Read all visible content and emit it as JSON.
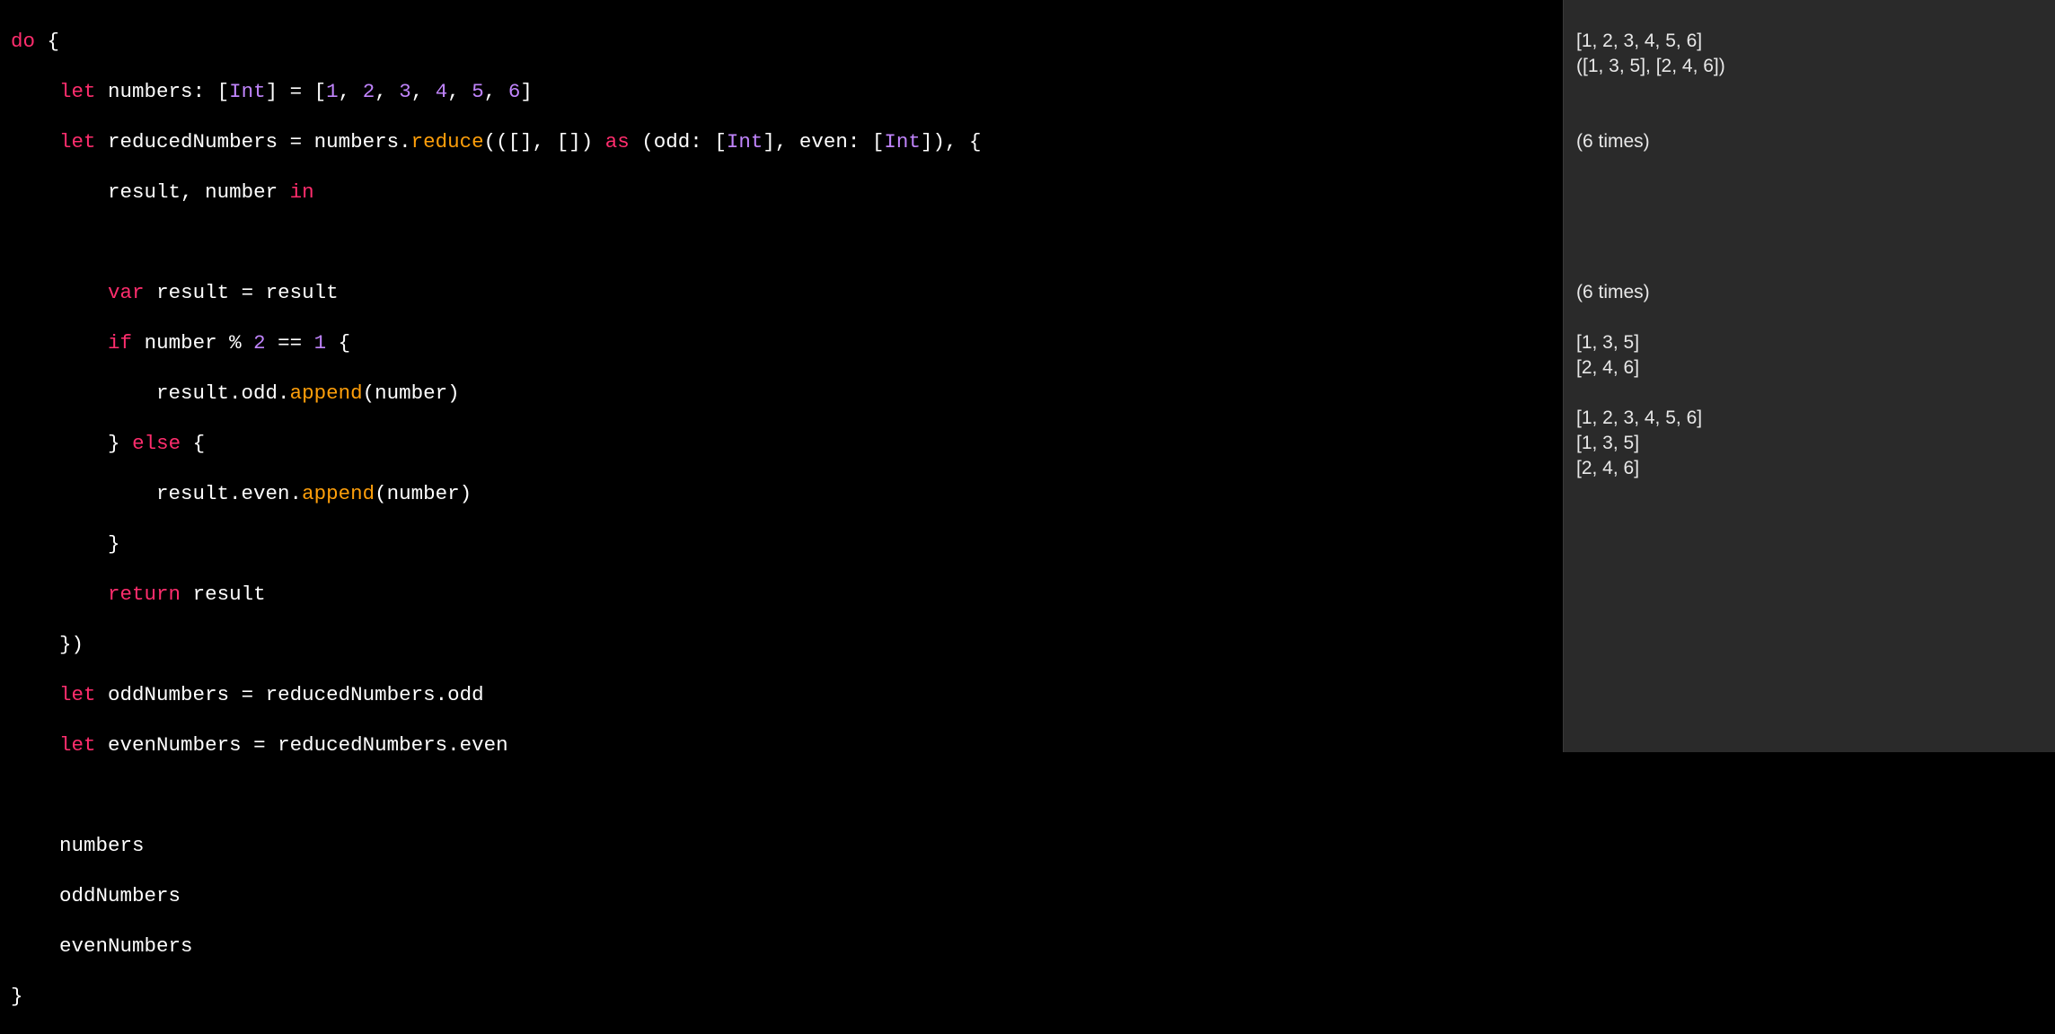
{
  "code": {
    "l1": {
      "do": "do",
      "brace": " {"
    },
    "l2": {
      "indent": "    ",
      "let": "let",
      "sp1": " ",
      "numbers": "numbers",
      "colon": ": ",
      "lbr": "[",
      "int": "Int",
      "rbr": "]",
      "eq": " = ",
      "l": "[",
      "n1": "1",
      "c1": ", ",
      "n2": "2",
      "c2": ", ",
      "n3": "3",
      "c3": ", ",
      "n4": "4",
      "c4": ", ",
      "n5": "5",
      "c5": ", ",
      "n6": "6",
      "r": "]"
    },
    "l3": {
      "indent": "    ",
      "let": "let",
      "sp1": " ",
      "rn": "reducedNumbers",
      "eq": " = ",
      "numcall": "numbers.",
      "reduce": "reduce",
      "op": "((",
      "e1": "[]",
      "cm1": ", ",
      "e2": "[]",
      "cp": ")",
      "sp2": " ",
      "as": "as",
      "sp3": " ",
      "op2": "(",
      "odd": "odd",
      "co1": ": ",
      "lb1": "[",
      "int1": "Int",
      "rb1": "]",
      "cm2": ", ",
      "even": "even",
      "co2": ": ",
      "lb2": "[",
      "int2": "Int",
      "rb2": "]",
      "cp2": ")",
      "cm3": ", ",
      "ob": "{"
    },
    "l4": {
      "indent": "        ",
      "result": "result",
      "cm": ", ",
      "number": "number",
      "sp": " ",
      "in": "in"
    },
    "l5": {
      "blank": ""
    },
    "l6": {
      "indent": "        ",
      "var": "var",
      "sp": " ",
      "result": "result",
      "eq": " = ",
      "result2": "result"
    },
    "l7": {
      "indent": "        ",
      "if": "if",
      "sp": " ",
      "number": "number",
      "op": " % ",
      "two": "2",
      "eq": " == ",
      "one": "1",
      "sp2": " ",
      "ob": "{"
    },
    "l8": {
      "indent": "            ",
      "resodd": "result.odd.",
      "append": "append",
      "op": "(",
      "number": "number",
      "cp": ")"
    },
    "l9": {
      "indent": "        ",
      "cb": "}",
      "sp": " ",
      "else": "else",
      "sp2": " ",
      "ob": "{"
    },
    "l10": {
      "indent": "            ",
      "reseven": "result.even.",
      "append": "append",
      "op": "(",
      "number": "number",
      "cp": ")"
    },
    "l11": {
      "indent": "        ",
      "cb": "}"
    },
    "l12": {
      "indent": "        ",
      "return": "return",
      "sp": " ",
      "result": "result"
    },
    "l13": {
      "indent": "    ",
      "cb": "})"
    },
    "l14": {
      "indent": "    ",
      "let": "let",
      "sp": " ",
      "oddN": "oddNumbers",
      "eq": " = ",
      "rhs": "reducedNumbers.odd"
    },
    "l15": {
      "indent": "    ",
      "let": "let",
      "sp": " ",
      "evenN": "evenNumbers",
      "eq": " = ",
      "rhs": "reducedNumbers.even"
    },
    "l16": {
      "blank": ""
    },
    "l17": {
      "indent": "    ",
      "t": "numbers"
    },
    "l18": {
      "indent": "    ",
      "t": "oddNumbers"
    },
    "l19": {
      "indent": "    ",
      "t": "evenNumbers"
    },
    "l20": {
      "cb": "}"
    }
  },
  "sidebar": {
    "r1": "",
    "r2": "[1, 2, 3, 4, 5, 6]",
    "r3": "([1, 3, 5], [2, 4, 6])",
    "r4": "",
    "r5": "",
    "r6": "(6 times)",
    "r7": "",
    "r8": "",
    "r9": "",
    "r10": "",
    "r11": "",
    "r12": "(6 times)",
    "r13": "",
    "r14": "[1, 3, 5]",
    "r15": "[2, 4, 6]",
    "r16": "",
    "r17": "[1, 2, 3, 4, 5, 6]",
    "r18": "[1, 3, 5]",
    "r19": "[2, 4, 6]",
    "r20": ""
  }
}
